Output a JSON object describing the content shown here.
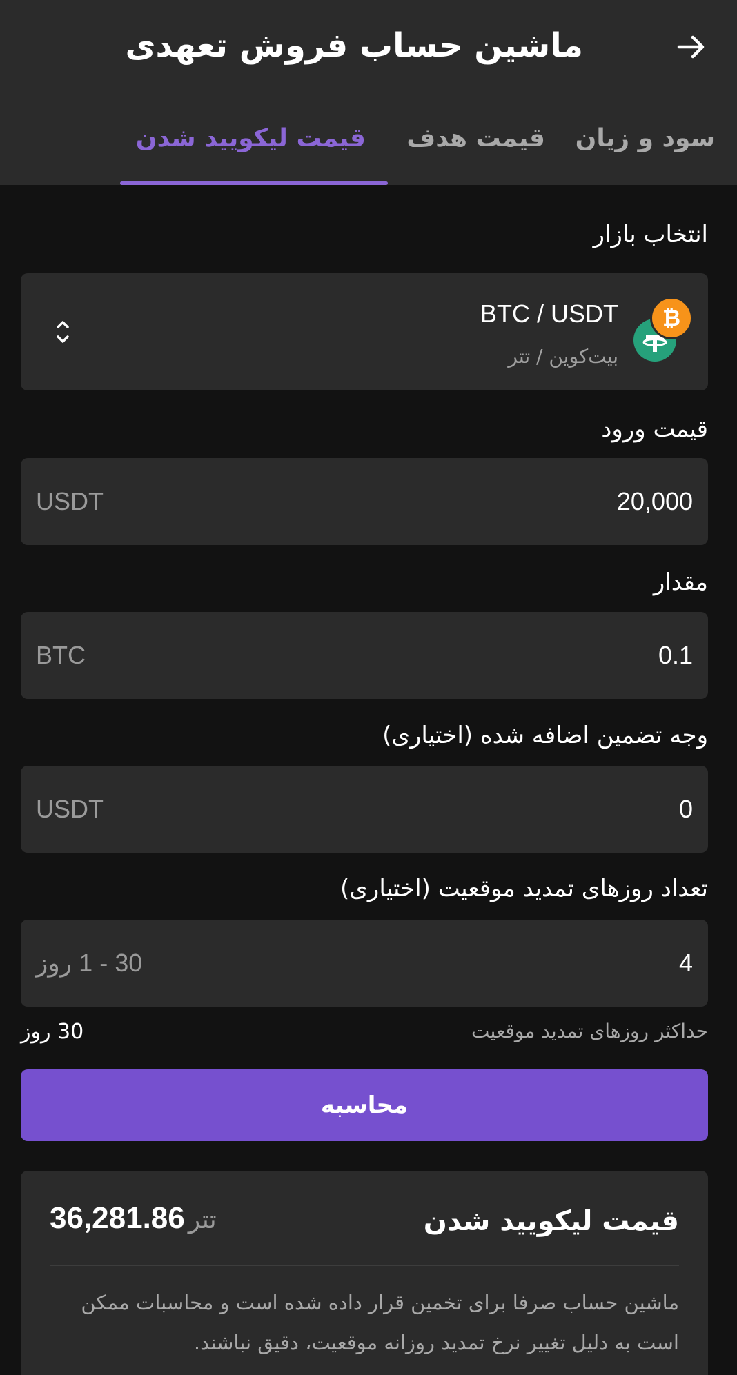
{
  "header": {
    "title": "ماشین حساب فروش تعهدی",
    "tabs": [
      {
        "label": "سود و زیان",
        "active": false
      },
      {
        "label": "قیمت هدف",
        "active": false
      },
      {
        "label": "قیمت لیکویید شدن",
        "active": true
      }
    ]
  },
  "market": {
    "label": "انتخاب بازار",
    "pair": "BTC / USDT",
    "pair_fa": "بیت‌کوین / تتر",
    "base_icon": "bitcoin-icon",
    "quote_icon": "tether-icon"
  },
  "entry_price": {
    "label": "قیمت ورود",
    "value": "20,000",
    "unit": "USDT"
  },
  "amount": {
    "label": "مقدار",
    "value": "0.1",
    "unit": "BTC"
  },
  "collateral": {
    "label": "وجه تضمین اضافه شده (اختیاری)",
    "value": "0",
    "unit": "USDT"
  },
  "extension_days": {
    "label": "تعداد روزهای تمدید موقعیت (اختیاری)",
    "value": "4",
    "placeholder": "30 - 1 روز",
    "max_label": "حداکثر روزهای تمدید موقعیت",
    "max_value": "30 روز"
  },
  "calculate_button": "محاسبه",
  "result": {
    "label": "قیمت لیکویید شدن",
    "value": "36,281.86",
    "unit": "تتر",
    "note": "ماشین حساب صرفا برای تخمین قرار داده شده است و محاسبات ممکن است به دلیل تغییر نرخ تمدید روزانه موقعیت، دقیق نباشند."
  },
  "colors": {
    "accent": "#7650cf",
    "tab_active": "#8b66d6",
    "background": "#121212",
    "surface": "#2b2b2b"
  }
}
